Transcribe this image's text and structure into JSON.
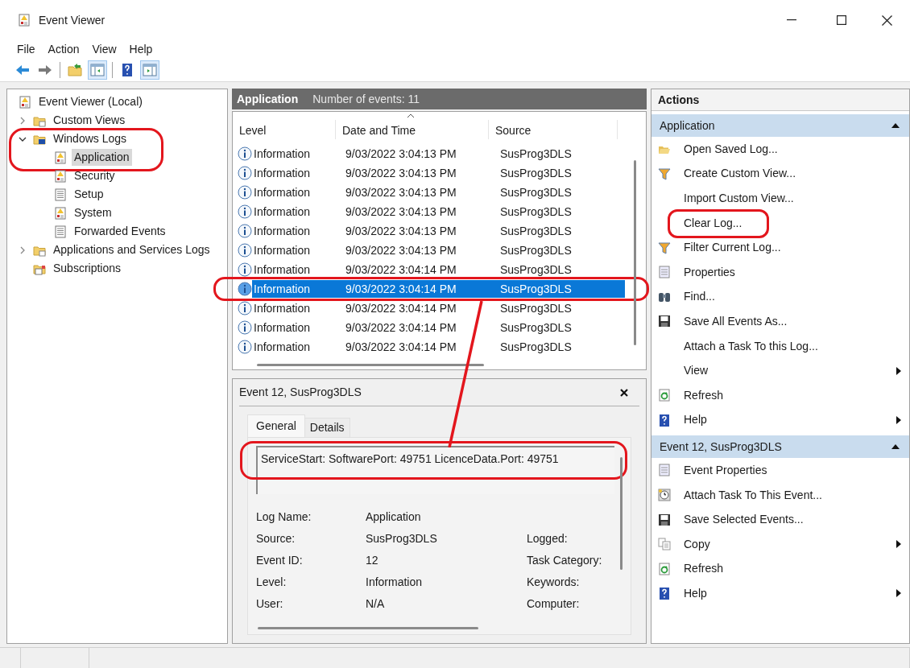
{
  "window": {
    "title": "Event Viewer"
  },
  "menu": [
    "File",
    "Action",
    "View",
    "Help"
  ],
  "toolbar": [
    {
      "kind": "back",
      "pressed": false
    },
    {
      "kind": "forward",
      "pressed": false
    },
    {
      "kind": "separator"
    },
    {
      "kind": "up-folder",
      "pressed": false
    },
    {
      "kind": "tree-pane",
      "pressed": true
    },
    {
      "kind": "separator"
    },
    {
      "kind": "help",
      "pressed": false
    },
    {
      "kind": "action-pane",
      "pressed": true
    }
  ],
  "tree": [
    {
      "label": "Event Viewer (Local)",
      "kind": "log",
      "selected": false,
      "circled": false,
      "children": [
        {
          "label": "Custom Views",
          "kind": "folder",
          "expanded": false,
          "selected": false,
          "circled": false
        },
        {
          "label": "Windows Logs",
          "kind": "folder-pc",
          "expanded": true,
          "selected": false,
          "circled": true,
          "children": [
            {
              "label": "Application",
              "kind": "log",
              "selected": true,
              "circled": false
            },
            {
              "label": "Security",
              "kind": "log",
              "selected": false,
              "circled": false
            },
            {
              "label": "Setup",
              "kind": "page",
              "selected": false,
              "circled": false
            },
            {
              "label": "System",
              "kind": "log",
              "selected": false,
              "circled": false
            },
            {
              "label": "Forwarded Events",
              "kind": "page",
              "selected": false,
              "circled": false
            }
          ]
        },
        {
          "label": "Applications and Services Logs",
          "kind": "folder",
          "expanded": false,
          "selected": false,
          "circled": false
        },
        {
          "label": "Subscriptions",
          "kind": "subscription",
          "selected": false,
          "circled": false
        }
      ]
    }
  ],
  "events": {
    "title": "Application",
    "count": "Number of events: 11",
    "columns": [
      {
        "label": "Level",
        "sorted": false
      },
      {
        "label": "Date and Time",
        "sorted": true
      },
      {
        "label": "Source",
        "sorted": false
      }
    ],
    "rows": [
      {
        "level": "Information",
        "date": "9/03/2022 3:04:13 PM",
        "source": "SusProg3DLS",
        "selected": false,
        "circled": false
      },
      {
        "level": "Information",
        "date": "9/03/2022 3:04:13 PM",
        "source": "SusProg3DLS",
        "selected": false,
        "circled": false
      },
      {
        "level": "Information",
        "date": "9/03/2022 3:04:13 PM",
        "source": "SusProg3DLS",
        "selected": false,
        "circled": false
      },
      {
        "level": "Information",
        "date": "9/03/2022 3:04:13 PM",
        "source": "SusProg3DLS",
        "selected": false,
        "circled": false
      },
      {
        "level": "Information",
        "date": "9/03/2022 3:04:13 PM",
        "source": "SusProg3DLS",
        "selected": false,
        "circled": false
      },
      {
        "level": "Information",
        "date": "9/03/2022 3:04:13 PM",
        "source": "SusProg3DLS",
        "selected": false,
        "circled": false
      },
      {
        "level": "Information",
        "date": "9/03/2022 3:04:14 PM",
        "source": "SusProg3DLS",
        "selected": false,
        "circled": false
      },
      {
        "level": "Information",
        "date": "9/03/2022 3:04:14 PM",
        "source": "SusProg3DLS",
        "selected": true,
        "circled": true
      },
      {
        "level": "Information",
        "date": "9/03/2022 3:04:14 PM",
        "source": "SusProg3DLS",
        "selected": false,
        "circled": false
      },
      {
        "level": "Information",
        "date": "9/03/2022 3:04:14 PM",
        "source": "SusProg3DLS",
        "selected": false,
        "circled": false
      },
      {
        "level": "Information",
        "date": "9/03/2022 3:04:14 PM",
        "source": "SusProg3DLS",
        "selected": false,
        "circled": false
      }
    ]
  },
  "detail": {
    "title": "Event 12, SusProg3DLS",
    "tabs": [
      {
        "label": "General",
        "selected": true
      },
      {
        "label": "Details",
        "selected": false
      }
    ],
    "description": {
      "text": "ServiceStart: SoftwarePort: 49751 LicenceData.Port: 49751",
      "circled": true
    },
    "fields": [
      {
        "label": "Log Name:",
        "value": "Application"
      },
      {
        "label": "Source:",
        "value": "SusProg3DLS",
        "right_label": "Logged:"
      },
      {
        "label": "Event ID:",
        "value": "12",
        "right_label": "Task Category:"
      },
      {
        "label": "Level:",
        "value": "Information",
        "right_label": "Keywords:"
      },
      {
        "label": "User:",
        "value": "N/A",
        "right_label": "Computer:"
      }
    ]
  },
  "actions": {
    "title": "Actions",
    "sections": [
      {
        "title": "Application",
        "expanded": true,
        "items": [
          {
            "label": "Open Saved Log...",
            "kind": "open-folder",
            "submenu": false,
            "circled": false
          },
          {
            "label": "Create Custom View...",
            "kind": "funnel",
            "submenu": false,
            "circled": false
          },
          {
            "label": "Import Custom View...",
            "kind": "plain",
            "submenu": false,
            "circled": false
          },
          {
            "label": "Clear Log...",
            "kind": "plain",
            "submenu": false,
            "circled": true
          },
          {
            "label": "Filter Current Log...",
            "kind": "funnel",
            "submenu": false,
            "circled": false
          },
          {
            "label": "Properties",
            "kind": "properties",
            "submenu": false,
            "circled": false
          },
          {
            "label": "Find...",
            "kind": "binoculars",
            "submenu": false,
            "circled": false
          },
          {
            "label": "Save All Events As...",
            "kind": "floppy",
            "submenu": false,
            "circled": false
          },
          {
            "label": "Attach a Task To this Log...",
            "kind": "plain",
            "submenu": false,
            "circled": false
          },
          {
            "label": "View",
            "kind": "plain",
            "submenu": true,
            "circled": false
          },
          {
            "label": "Refresh",
            "kind": "refresh",
            "submenu": false,
            "circled": false
          },
          {
            "label": "Help",
            "kind": "help",
            "submenu": true,
            "circled": false
          }
        ]
      },
      {
        "title": "Event 12, SusProg3DLS",
        "expanded": true,
        "items": [
          {
            "label": "Event Properties",
            "kind": "properties",
            "submenu": false,
            "circled": false
          },
          {
            "label": "Attach Task To This Event...",
            "kind": "clock",
            "submenu": false,
            "circled": false
          },
          {
            "label": "Save Selected Events...",
            "kind": "floppy",
            "submenu": false,
            "circled": false
          },
          {
            "label": "Copy",
            "kind": "copy",
            "submenu": true,
            "circled": false
          },
          {
            "label": "Refresh",
            "kind": "refresh",
            "submenu": false,
            "circled": false
          },
          {
            "label": "Help",
            "kind": "help",
            "submenu": true,
            "circled": false
          }
        ]
      }
    ]
  }
}
